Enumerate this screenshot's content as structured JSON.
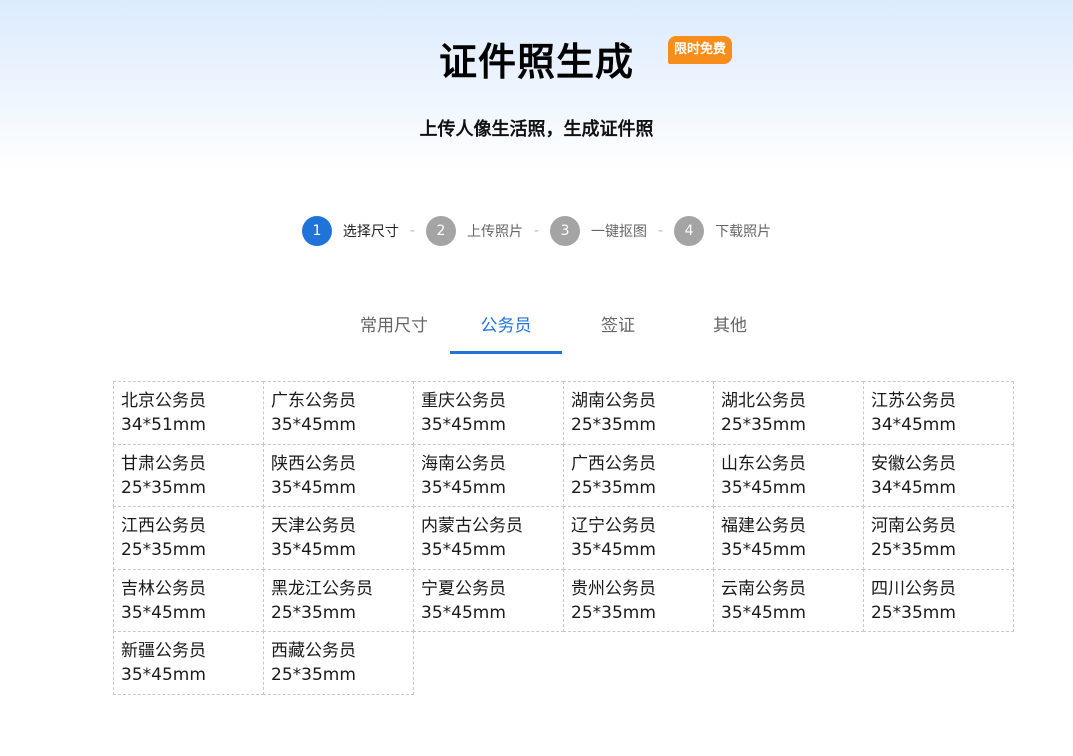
{
  "header": {
    "title": "证件照生成",
    "badge": "限时免费",
    "subtitle": "上传人像生活照，生成证件照"
  },
  "steps": [
    {
      "num": "1",
      "label": "选择尺寸",
      "active": true
    },
    {
      "num": "2",
      "label": "上传照片",
      "active": false
    },
    {
      "num": "3",
      "label": "一键抠图",
      "active": false
    },
    {
      "num": "4",
      "label": "下载照片",
      "active": false
    }
  ],
  "step_separator": "-",
  "tabs": [
    {
      "label": "常用尺寸",
      "active": false
    },
    {
      "label": "公务员",
      "active": true
    },
    {
      "label": "签证",
      "active": false
    },
    {
      "label": "其他",
      "active": false
    }
  ],
  "sizes": [
    {
      "name": "北京公务员",
      "size": "34*51mm"
    },
    {
      "name": "广东公务员",
      "size": "35*45mm"
    },
    {
      "name": "重庆公务员",
      "size": "35*45mm"
    },
    {
      "name": "湖南公务员",
      "size": "25*35mm"
    },
    {
      "name": "湖北公务员",
      "size": "25*35mm"
    },
    {
      "name": "江苏公务员",
      "size": "34*45mm"
    },
    {
      "name": "甘肃公务员",
      "size": "25*35mm"
    },
    {
      "name": "陕西公务员",
      "size": "35*45mm"
    },
    {
      "name": "海南公务员",
      "size": "35*45mm"
    },
    {
      "name": "广西公务员",
      "size": "25*35mm"
    },
    {
      "name": "山东公务员",
      "size": "35*45mm"
    },
    {
      "name": "安徽公务员",
      "size": "34*45mm"
    },
    {
      "name": "江西公务员",
      "size": "25*35mm"
    },
    {
      "name": "天津公务员",
      "size": "35*45mm"
    },
    {
      "name": "内蒙古公务员",
      "size": "35*45mm"
    },
    {
      "name": "辽宁公务员",
      "size": "35*45mm"
    },
    {
      "name": "福建公务员",
      "size": "35*45mm"
    },
    {
      "name": "河南公务员",
      "size": "25*35mm"
    },
    {
      "name": "吉林公务员",
      "size": "35*45mm"
    },
    {
      "name": "黑龙江公务员",
      "size": "25*35mm"
    },
    {
      "name": "宁夏公务员",
      "size": "35*45mm"
    },
    {
      "name": "贵州公务员",
      "size": "25*35mm"
    },
    {
      "name": "云南公务员",
      "size": "35*45mm"
    },
    {
      "name": "四川公务员",
      "size": "25*35mm"
    },
    {
      "name": "新疆公务员",
      "size": "35*45mm"
    },
    {
      "name": "西藏公务员",
      "size": "25*35mm"
    }
  ],
  "colors": {
    "accent": "#2073d8",
    "badge": "#f78d1a",
    "step_inactive": "#a4a4a4"
  }
}
